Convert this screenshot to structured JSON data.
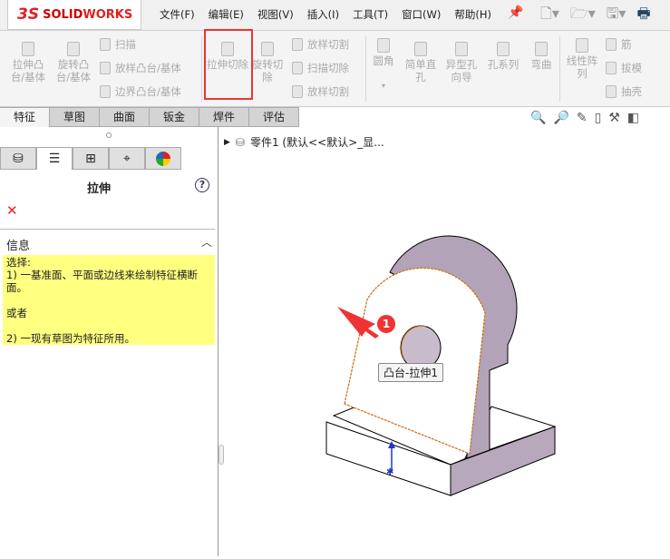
{
  "app": {
    "logo_ds": "3S",
    "logo_text_a": "SOLID",
    "logo_text_b": "WORKS"
  },
  "menu": [
    "文件(F)",
    "编辑(E)",
    "视图(V)",
    "插入(I)",
    "工具(T)",
    "窗口(W)",
    "帮助(H)"
  ],
  "ribbon": {
    "extrude_boss": "拉伸凸台/基体",
    "revolve_boss": "旋转凸台/基体",
    "sweep": "扫描",
    "loft_boss": "放样凸台/基体",
    "boundary_boss": "边界凸台/基体",
    "extrude_cut": "拉伸切除",
    "revolve_cut": "旋转切除",
    "loft_cut": "放样切割",
    "sweep_cut": "扫描切除",
    "boundary_cut": "放样切割",
    "fillet": "圆角",
    "simple_hole": "简单直孔",
    "hole_wizard": "异型孔向导",
    "hole_series": "孔系列",
    "flex": "弯曲",
    "linear_pattern": "线性阵列",
    "rib": "筋",
    "draft": "拔模",
    "shell": "抽壳"
  },
  "tabs": [
    "特征",
    "草图",
    "曲面",
    "钣金",
    "焊件",
    "评估"
  ],
  "panel": {
    "title": "拉伸",
    "help": "?",
    "cancel": "✕",
    "info_header": "信息",
    "info_lines": [
      "选择:",
      "1) 一基准面、平面或边线来绘制特征横断面。",
      "",
      "或者",
      "",
      "2) 一现有草图为特征所用。"
    ]
  },
  "tree": {
    "root": "零件1  (默认<<默认>_显..."
  },
  "viewport": {
    "tooltip": "凸台-拉伸1",
    "badge": "1"
  },
  "colors": {
    "highlight": "#e33333",
    "info_bg": "#ffff80",
    "edge": "#c87010"
  }
}
